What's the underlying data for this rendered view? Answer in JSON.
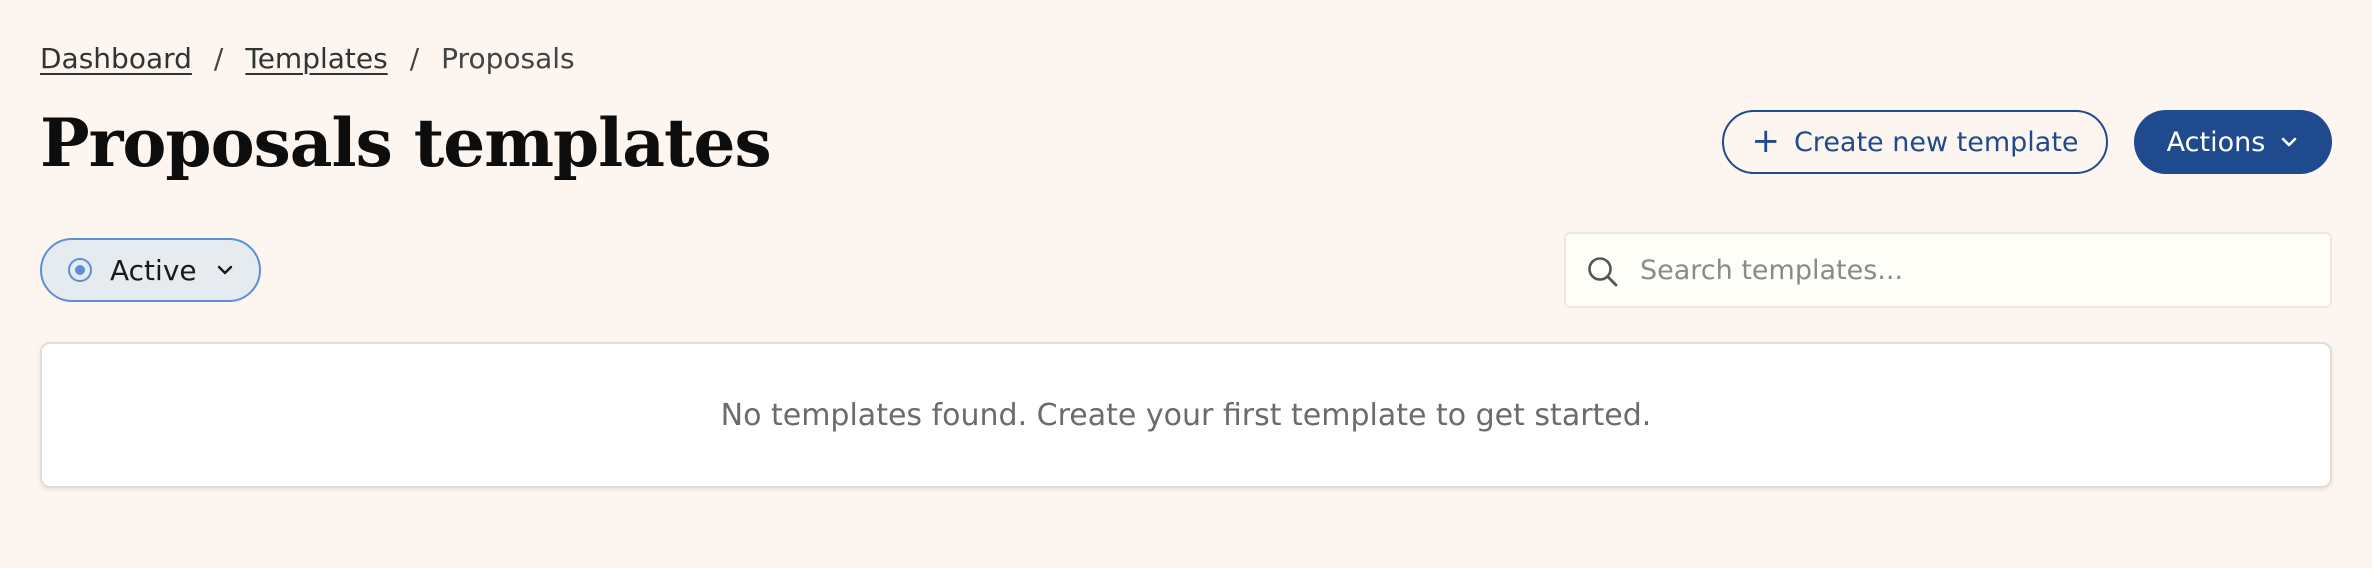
{
  "breadcrumb": {
    "items": [
      {
        "label": "Dashboard"
      },
      {
        "label": "Templates"
      },
      {
        "label": "Proposals"
      }
    ],
    "separator": "/"
  },
  "header": {
    "title": "Proposals templates",
    "create_button": {
      "label": "Create new template",
      "icon": "plus-icon"
    },
    "actions_button": {
      "label": "Actions",
      "icon": "chevron-down-icon"
    }
  },
  "filter": {
    "selected": "Active",
    "icon": "radio-selected-icon",
    "caret_icon": "chevron-down-icon"
  },
  "search": {
    "placeholder": "Search templates...",
    "value": "",
    "icon": "search-icon"
  },
  "empty_state": {
    "message": "No templates found. Create your first template to get started."
  },
  "colors": {
    "background": "#fcf5f0",
    "primary": "#1f4b8e",
    "filter_accent": "#5b8fd6",
    "filter_background": "#e6ebef",
    "card_background": "#ffffff",
    "muted_text": "#6b6b6b"
  }
}
